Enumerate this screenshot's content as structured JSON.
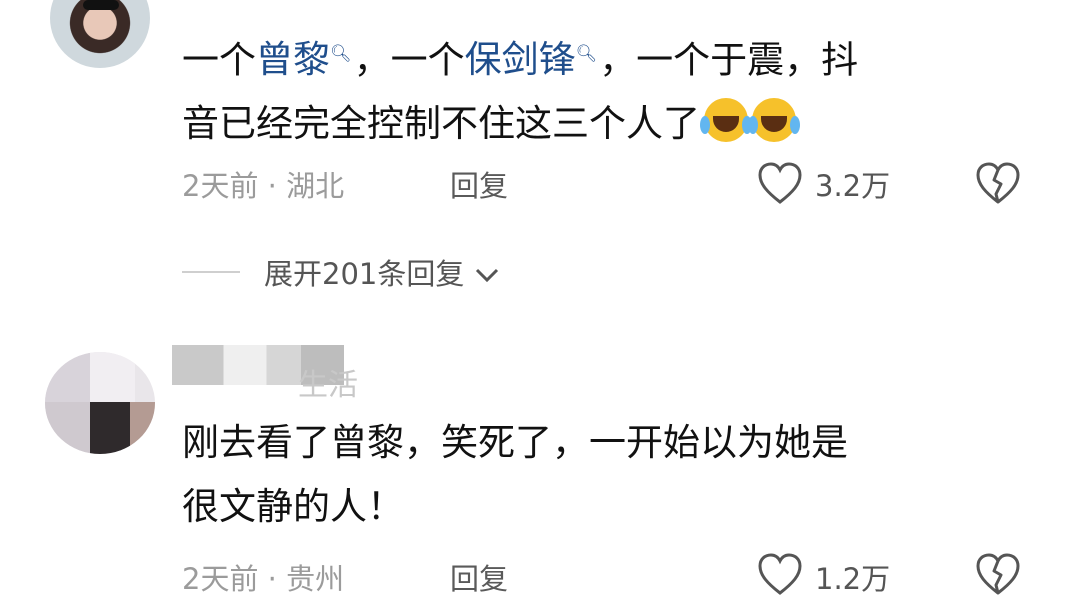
{
  "comment1": {
    "text_parts": [
      "一个",
      "曾黎",
      "，一个",
      "保剑锋",
      "，一个于震，抖",
      "音已经完全控制不住这三个人了"
    ],
    "emoji_count": 2,
    "meta": "2天前 · 湖北",
    "reply_label": "回复",
    "like_count": "3.2万",
    "expand_label": "展开201条回复"
  },
  "comment2": {
    "username_partial": "生活",
    "lines": [
      "刚去看了曾黎，笑死了，一开始以为她是",
      "很文静的人！"
    ],
    "meta": "2天前 · 贵州",
    "reply_label": "回复",
    "like_count": "1.2万"
  },
  "icons": {
    "like": "heart-outline-icon",
    "dislike": "broken-heart-icon",
    "search": "search-link-icon",
    "chevron": "chevron-down-icon"
  },
  "colors": {
    "link": "#1f4e8c",
    "meta": "#9b9b9b",
    "text": "#111111"
  }
}
